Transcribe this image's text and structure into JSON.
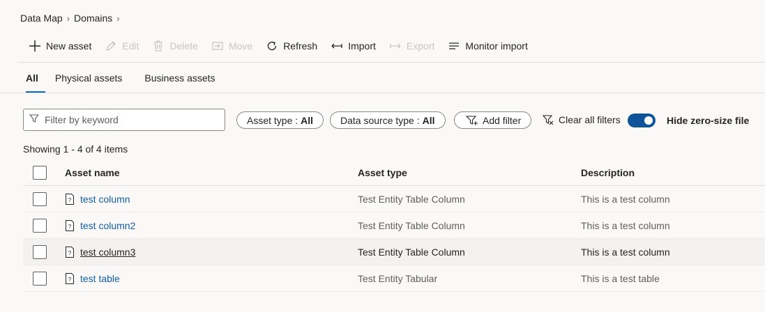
{
  "breadcrumb": [
    "Data Map",
    "Domains"
  ],
  "toolbar": {
    "new_asset": "New asset",
    "edit": "Edit",
    "delete": "Delete",
    "move": "Move",
    "refresh": "Refresh",
    "import": "Import",
    "export": "Export",
    "monitor_import": "Monitor import"
  },
  "tabs": [
    "All",
    "Physical assets",
    "Business assets"
  ],
  "filters": {
    "keyword_placeholder": "Filter by keyword",
    "asset_type_label": "Asset type :",
    "asset_type_value": "All",
    "data_source_label": "Data source type :",
    "data_source_value": "All",
    "add_filter": "Add filter",
    "clear_all": "Clear all filters",
    "hide_zero_size": "Hide zero-size file"
  },
  "showing": "Showing 1 - 4 of 4 items",
  "table": {
    "headers": [
      "Asset name",
      "Asset type",
      "Description"
    ],
    "rows": [
      {
        "name": "test column",
        "type": "Test Entity Table Column",
        "description": "This is a test column"
      },
      {
        "name": "test column2",
        "type": "Test Entity Table Column",
        "description": "This is a test column"
      },
      {
        "name": "test column3",
        "type": "Test Entity Table Column",
        "description": "This is a test column"
      },
      {
        "name": "test table",
        "type": "Test Entity Tabular",
        "description": "This is a test table"
      }
    ]
  },
  "colors": {
    "accent": "#0f6cbd",
    "toggle": "#0f5499",
    "link": "#115ea3"
  }
}
